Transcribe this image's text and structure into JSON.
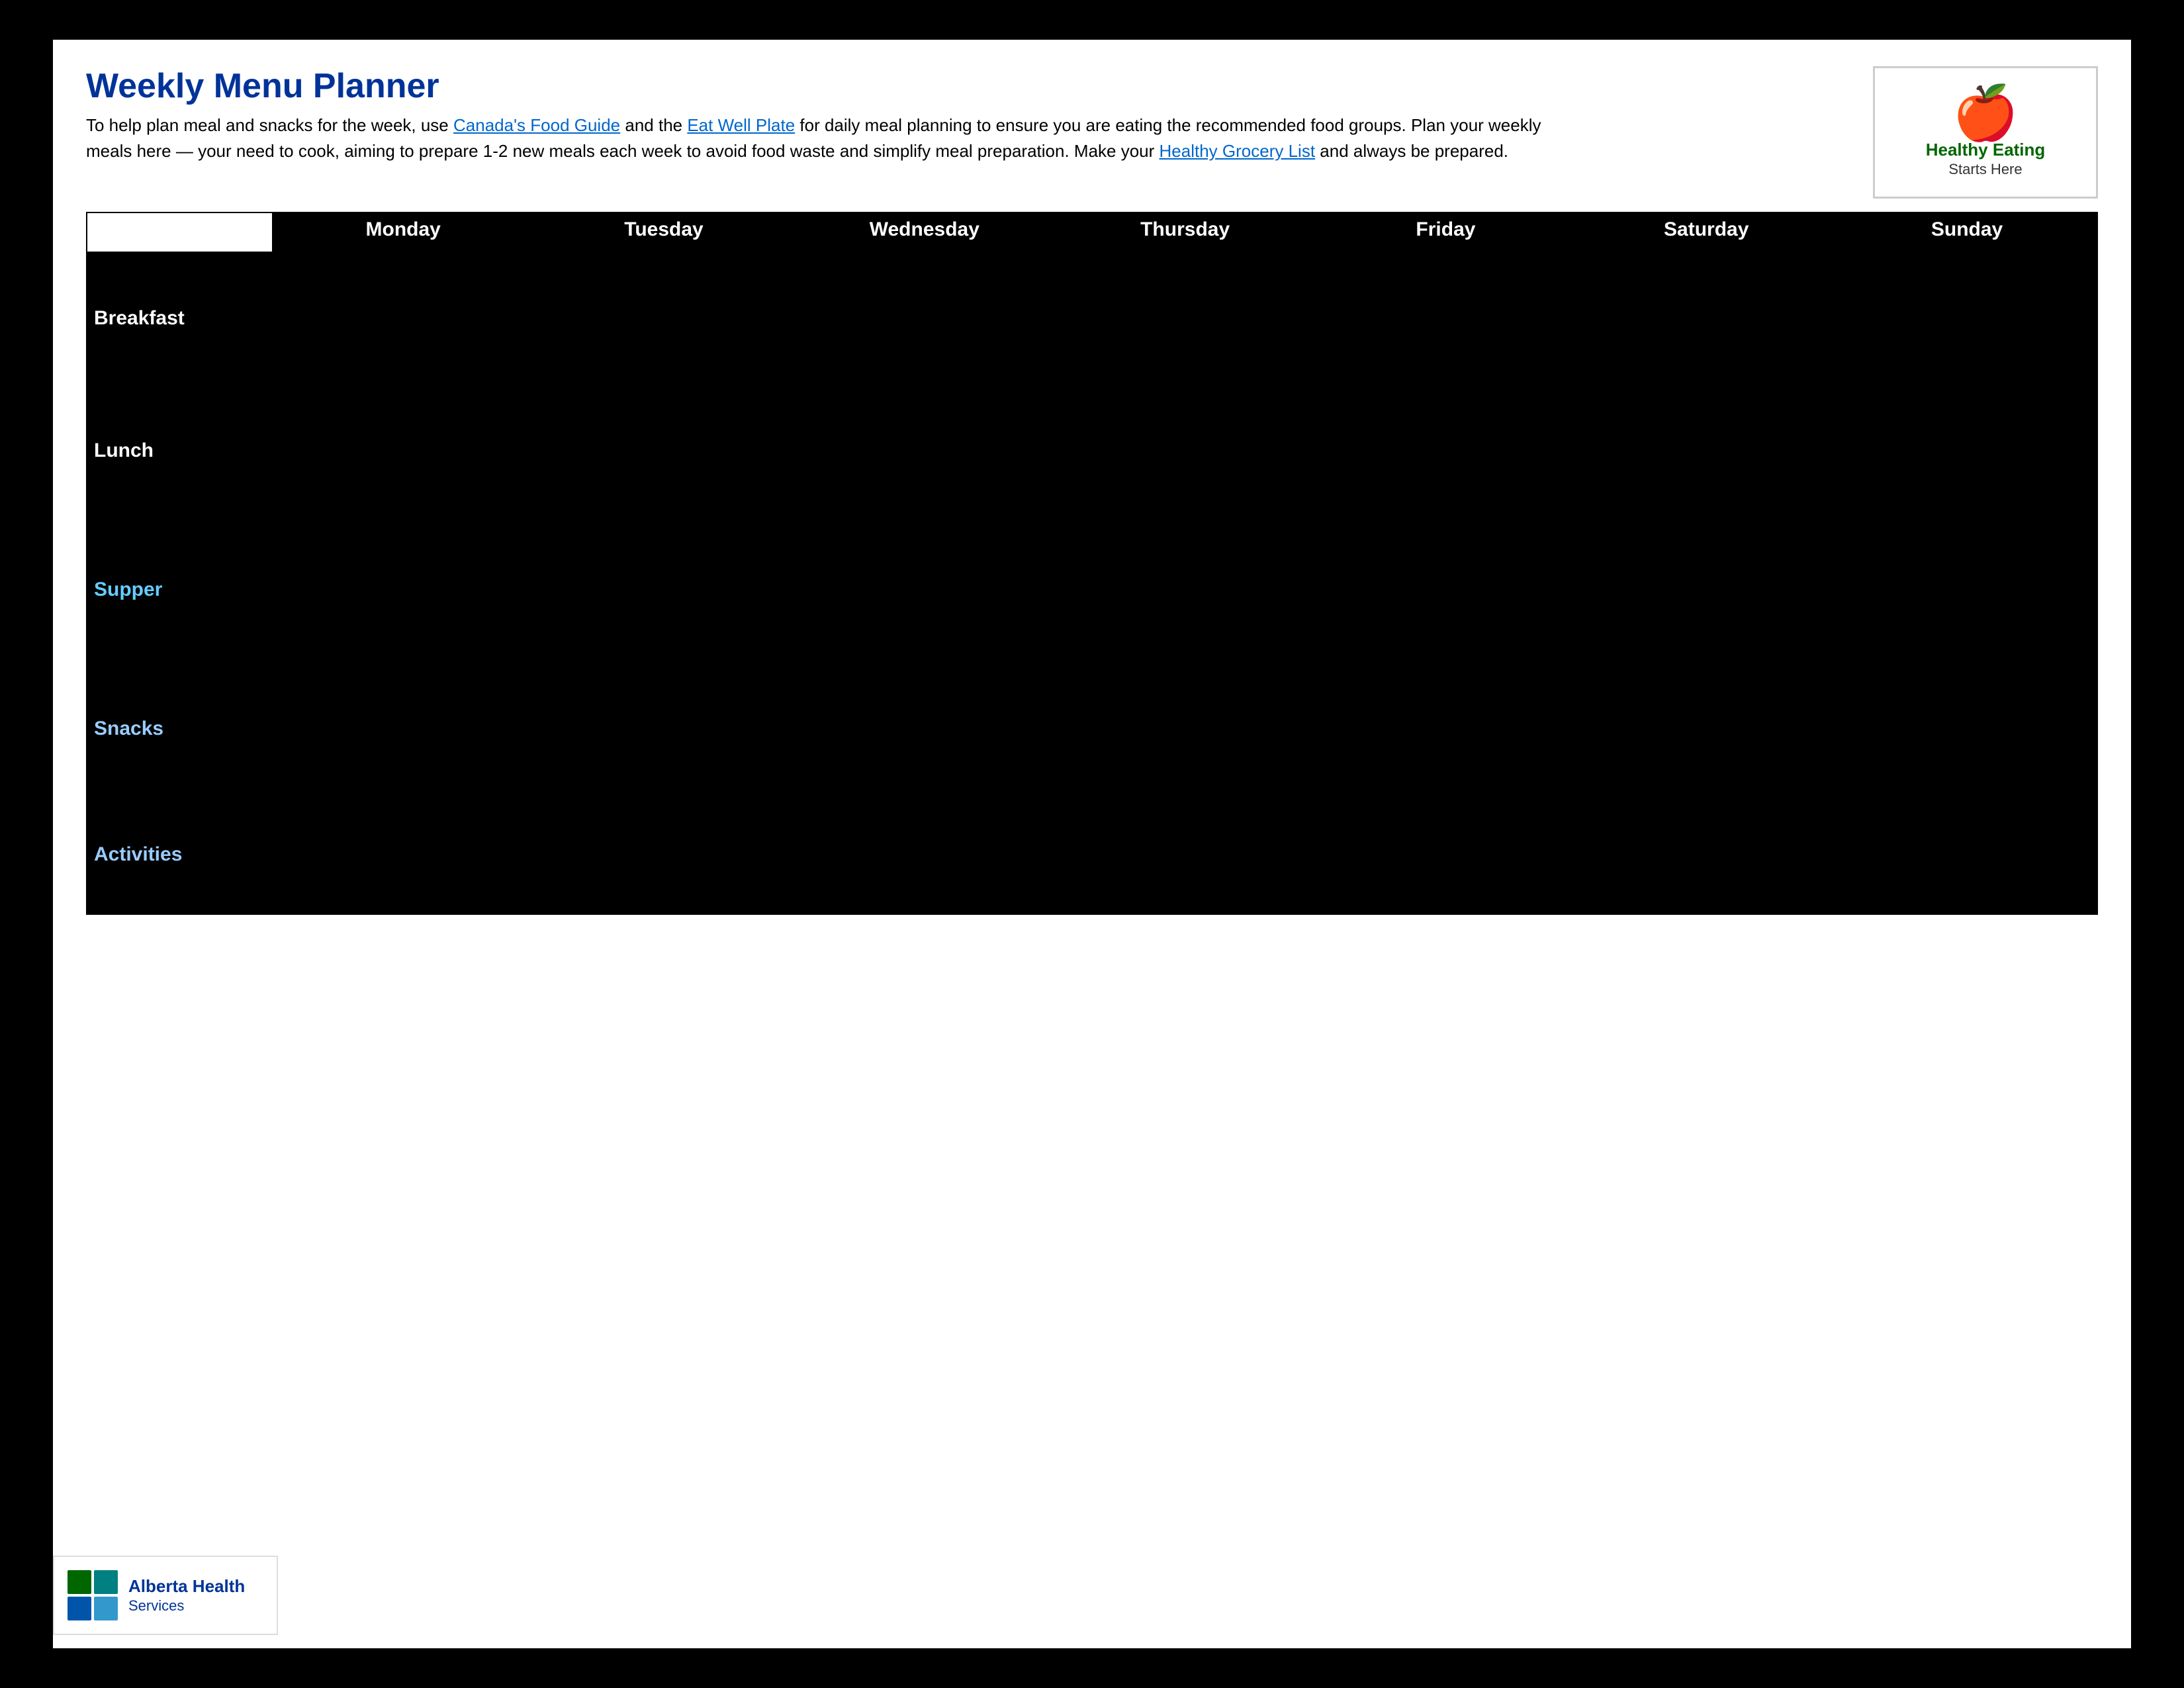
{
  "page": {
    "title": "Weekly Menu Planner",
    "description_before_link1": "To help plan meal and snacks for the week, use Canada's Food Guide and the Eat Well Plate for daily meal planning to ensure you are eating the recommended food groups. Plan your weekly meals here your need to cook, aiming to prepare 1-2 new meals each week to avoid food waste and simplify meal preparation. Make your own",
    "description_link1_text": "Canada's Food Guide",
    "description_link1_url": "#",
    "description_link2_text": "Eat Well Plate",
    "description_link2_url": "#",
    "description_link3_text": "Healthy Grocery List",
    "description_link3_url": "#",
    "description_after_link3": "and always be prepared."
  },
  "logo": {
    "healthy_text": "Healthy Eating",
    "starts_text": "Starts Here"
  },
  "table": {
    "headers": [
      "",
      "Monday",
      "Tuesday",
      "Wednesday",
      "Thursday",
      "Friday",
      "Saturday",
      "Sunday"
    ],
    "rows": [
      {
        "label": "Breakfast",
        "class": "breakfast"
      },
      {
        "label": "Lunch",
        "class": "lunch"
      },
      {
        "label": "Supper",
        "class": "supper"
      },
      {
        "label": "Snacks",
        "class": "snacks"
      },
      {
        "label": "Activities",
        "class": "activities"
      }
    ]
  },
  "footer": {
    "ahs_name": "Alberta Health",
    "ahs_sub": "Services",
    "page_info": ""
  }
}
